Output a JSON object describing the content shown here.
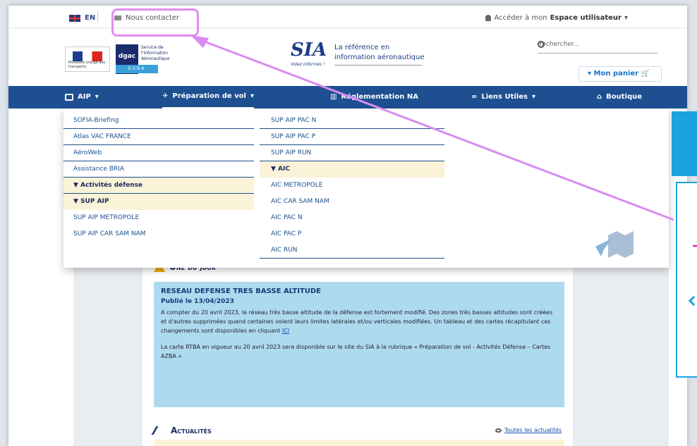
{
  "topbar": {
    "lang": "EN",
    "contact": "Nous contacter",
    "user_prefix": "Accéder à mon",
    "user_space": "Espace utilisateur"
  },
  "header": {
    "dgac": "dgac",
    "dgac_lines": "Service de l'Information Aéronautique",
    "dsna": "DSNA",
    "rf_caption": "Ministère chargé des transports",
    "sia": "SIA",
    "sia_line1": "La référence en",
    "sia_line2": "information aéronautique",
    "sia_slogan": "Volez informés !",
    "search_placeholder": "Rechercher...",
    "cart": "Mon panier"
  },
  "nav": {
    "items": [
      {
        "label": "AIP"
      },
      {
        "label": "Préparation de vol"
      },
      {
        "label": "Réglementation NA"
      },
      {
        "label": "Liens Utiles"
      },
      {
        "label": "Boutique"
      }
    ]
  },
  "dropdown": {
    "col1": [
      "SOFIA-Briefing",
      "Atlas VAC FRANCE",
      "AéroWeb",
      "Assistance BRIA",
      "▼ Activités défense",
      "▼ SUP AIP",
      "SUP AIP METROPOLE",
      "SUP AIP CAR SAM NAM"
    ],
    "col2": [
      "SUP AIP PAC N",
      "SUP AIP PAC P",
      "SUP AIP RUN",
      "▼ AIC",
      "AIC METROPOLE",
      "AIC CAR SAM NAM",
      "AIC PAC N",
      "AIC PAC P",
      "AIC RUN"
    ]
  },
  "une": {
    "heading": "Une du jour",
    "title": "RESEAU DEFENSE TRES BASSE ALTITUDE",
    "date": "Publié le 13/04/2023",
    "p1": "A compter du 20 avril 2023, le réseau très basse altitude de la défense est fortement modifié. Des zones très basses altitudes sont créées et d'autres supprimées quand certaines voient leurs limites latérales et/ou verticales modifiées. Un tableau et des cartes récapitulant ces changements sont disponibles en cliquant",
    "p1_link": "ICI",
    "p2": "La carte RTBA en vigueur au 20 avril 2023 sera disponible sur le site du SIA à la rubrique « Préparation de vol - Activités Défense – Cartes AZBA »"
  },
  "actu": {
    "heading": "Actualités",
    "all": "Toutes les actualités"
  },
  "colors": {
    "nav_bg": "#1d4f91",
    "highlight": "#e18cf2",
    "box_bg": "#aedaef",
    "panel": "#1aa3dd"
  }
}
